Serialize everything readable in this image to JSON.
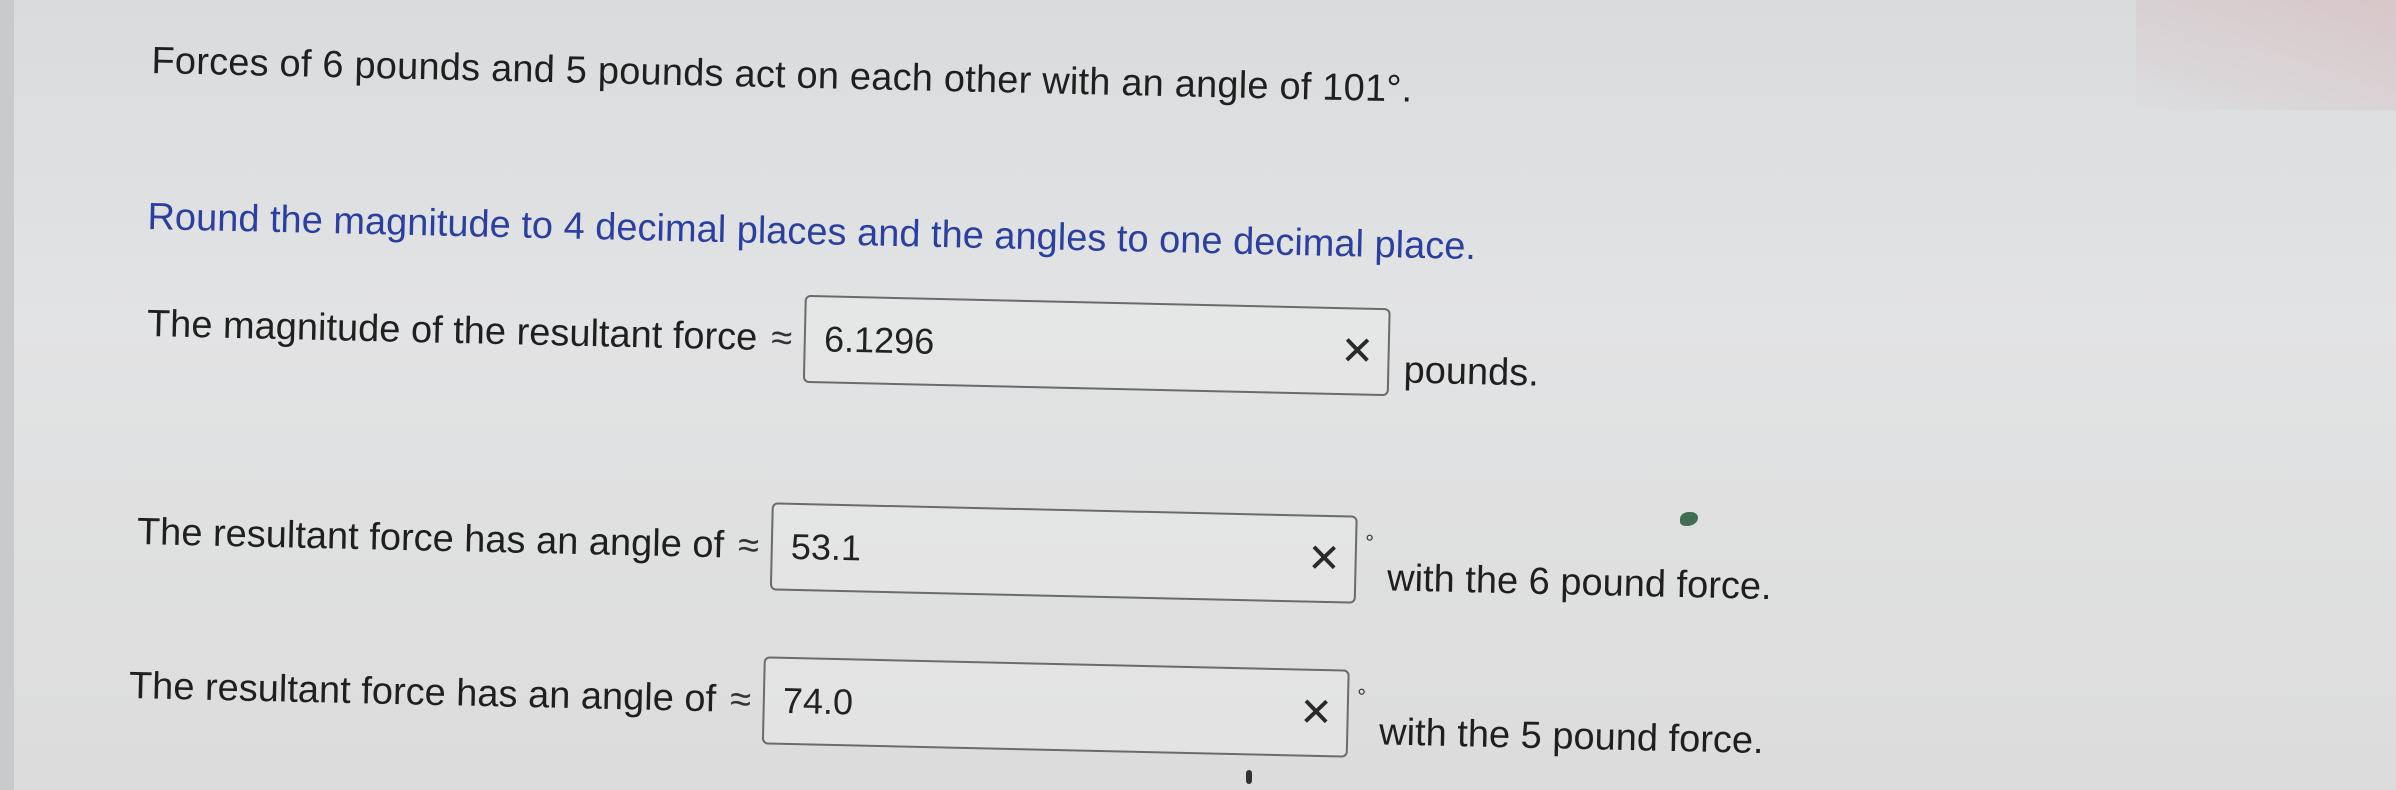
{
  "problem": {
    "statement": "Forces of 6 pounds and 5 pounds act on each other with an angle of 101°.",
    "instruction": "Round the magnitude to 4 decimal places and the angles to one decimal place."
  },
  "questions": [
    {
      "prefix": "The magnitude of the resultant force",
      "approx_symbol": "≈",
      "answer": "6.1296",
      "status_mark": "✕",
      "unit": "pounds."
    },
    {
      "prefix": "The resultant force has an angle of",
      "approx_symbol": "≈",
      "answer": "53.1",
      "status_mark": "✕",
      "degree_symbol": "°",
      "unit": "with the 6 pound force."
    },
    {
      "prefix": "The resultant force has an angle of",
      "approx_symbol": "≈",
      "answer": "74.0",
      "status_mark": "✕",
      "degree_symbol": "°",
      "unit": "with the 5 pound force."
    }
  ],
  "colors": {
    "instruction": "#2b3fa0",
    "text": "#1f1f1f",
    "box_border": "#6b6b6b"
  }
}
